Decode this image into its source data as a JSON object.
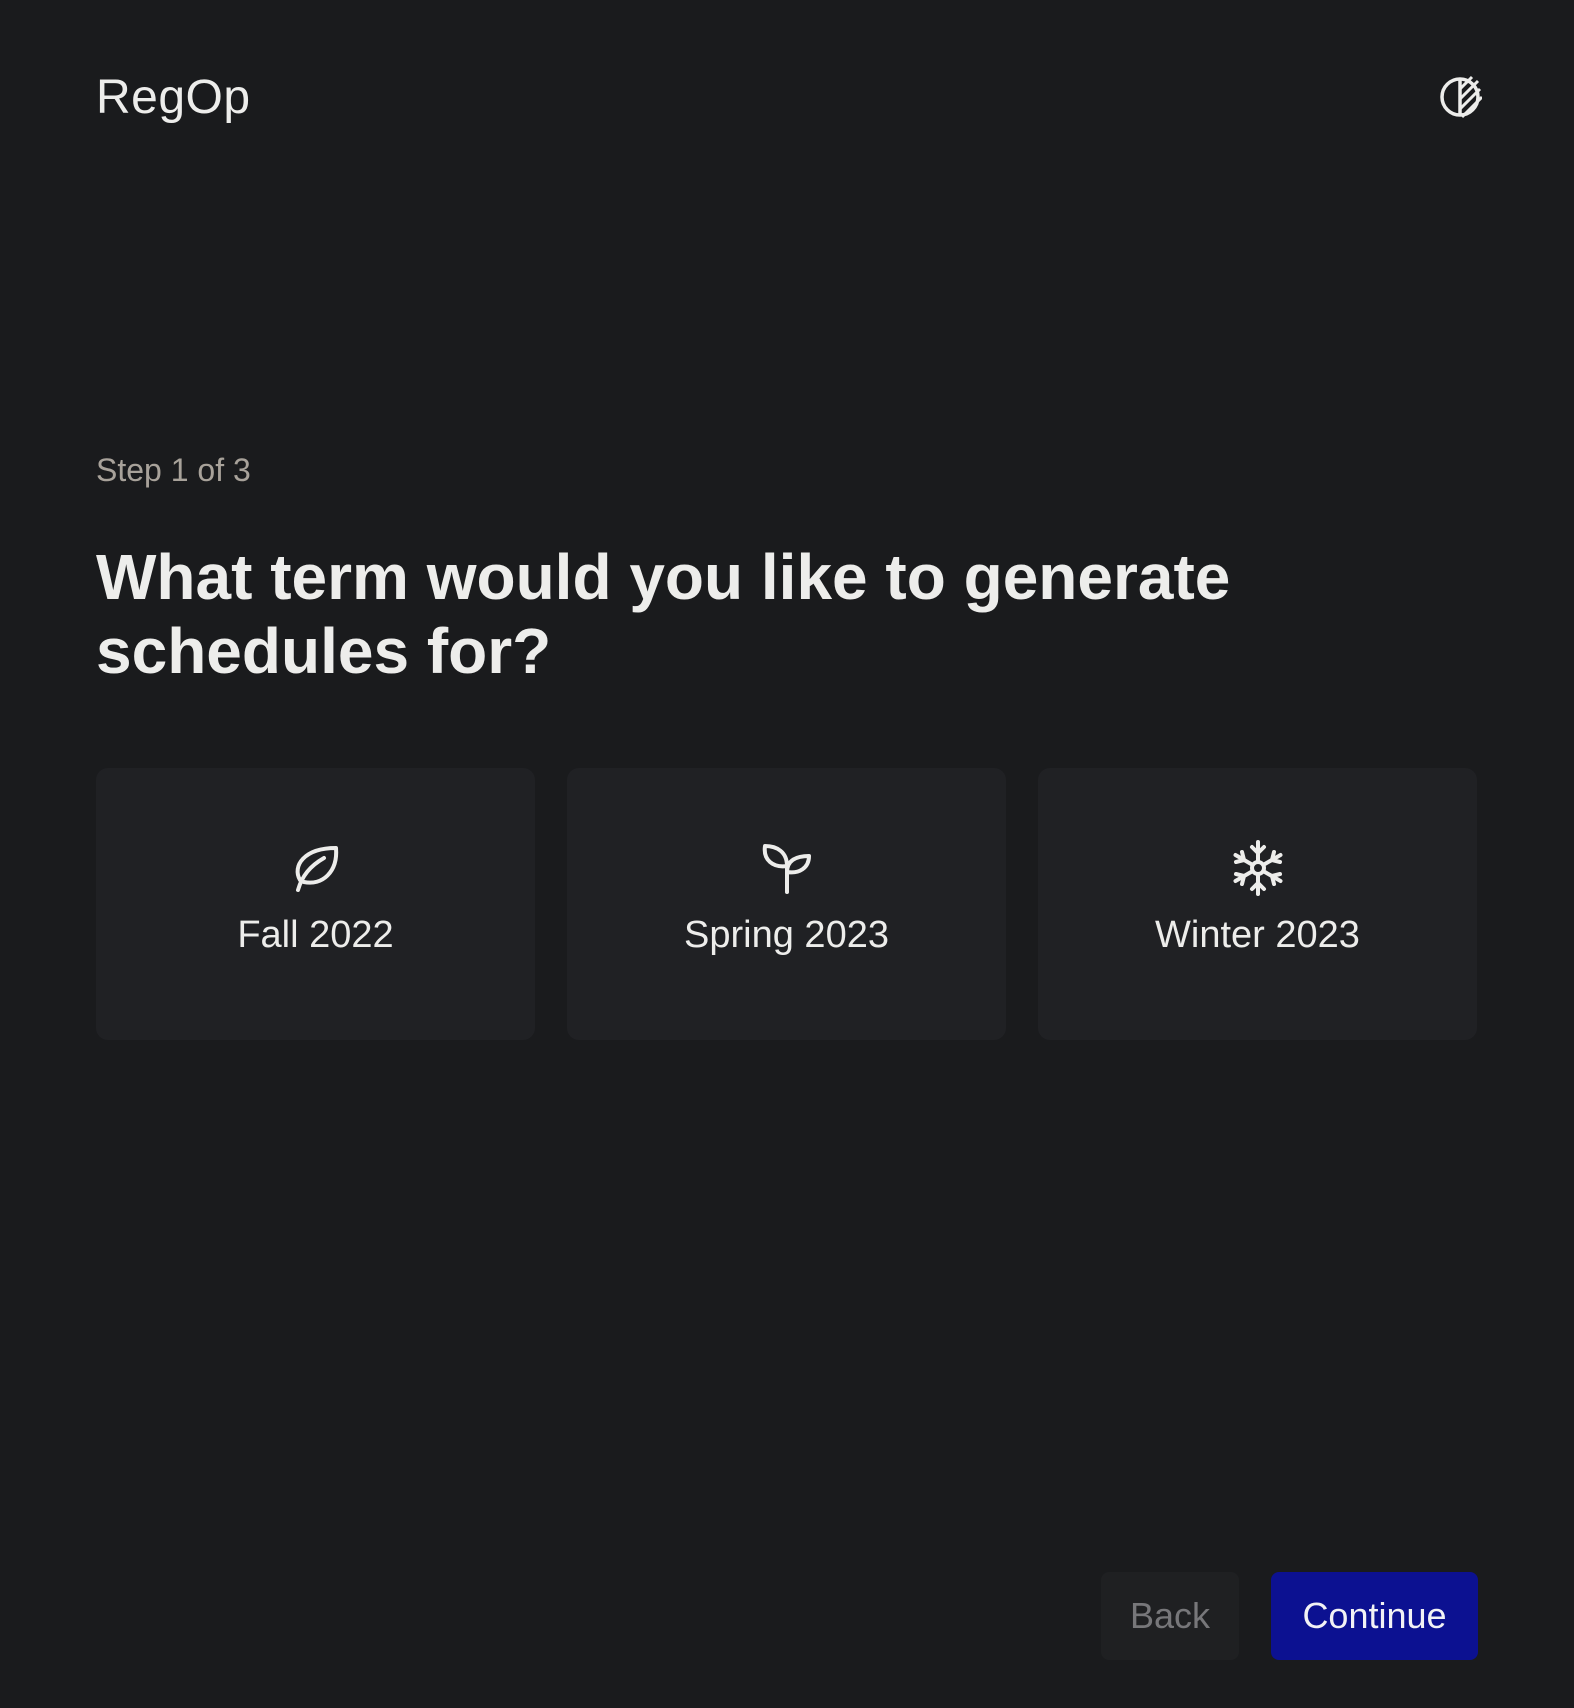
{
  "header": {
    "logo": "RegOp",
    "theme_toggle_icon": "contrast-icon"
  },
  "wizard": {
    "step_label": "Step 1 of 3",
    "question": "What term would you like to generate schedules for?",
    "options": [
      {
        "label": "Fall 2022",
        "icon": "leaf-icon"
      },
      {
        "label": "Spring 2023",
        "icon": "sprout-icon"
      },
      {
        "label": "Winter 2023",
        "icon": "snowflake-icon"
      }
    ]
  },
  "footer": {
    "back_label": "Back",
    "continue_label": "Continue"
  },
  "colors": {
    "background": "#1a1b1d",
    "card": "#202124",
    "text": "#ededeb",
    "muted": "#a8a29a",
    "accent": "#0c1191"
  }
}
